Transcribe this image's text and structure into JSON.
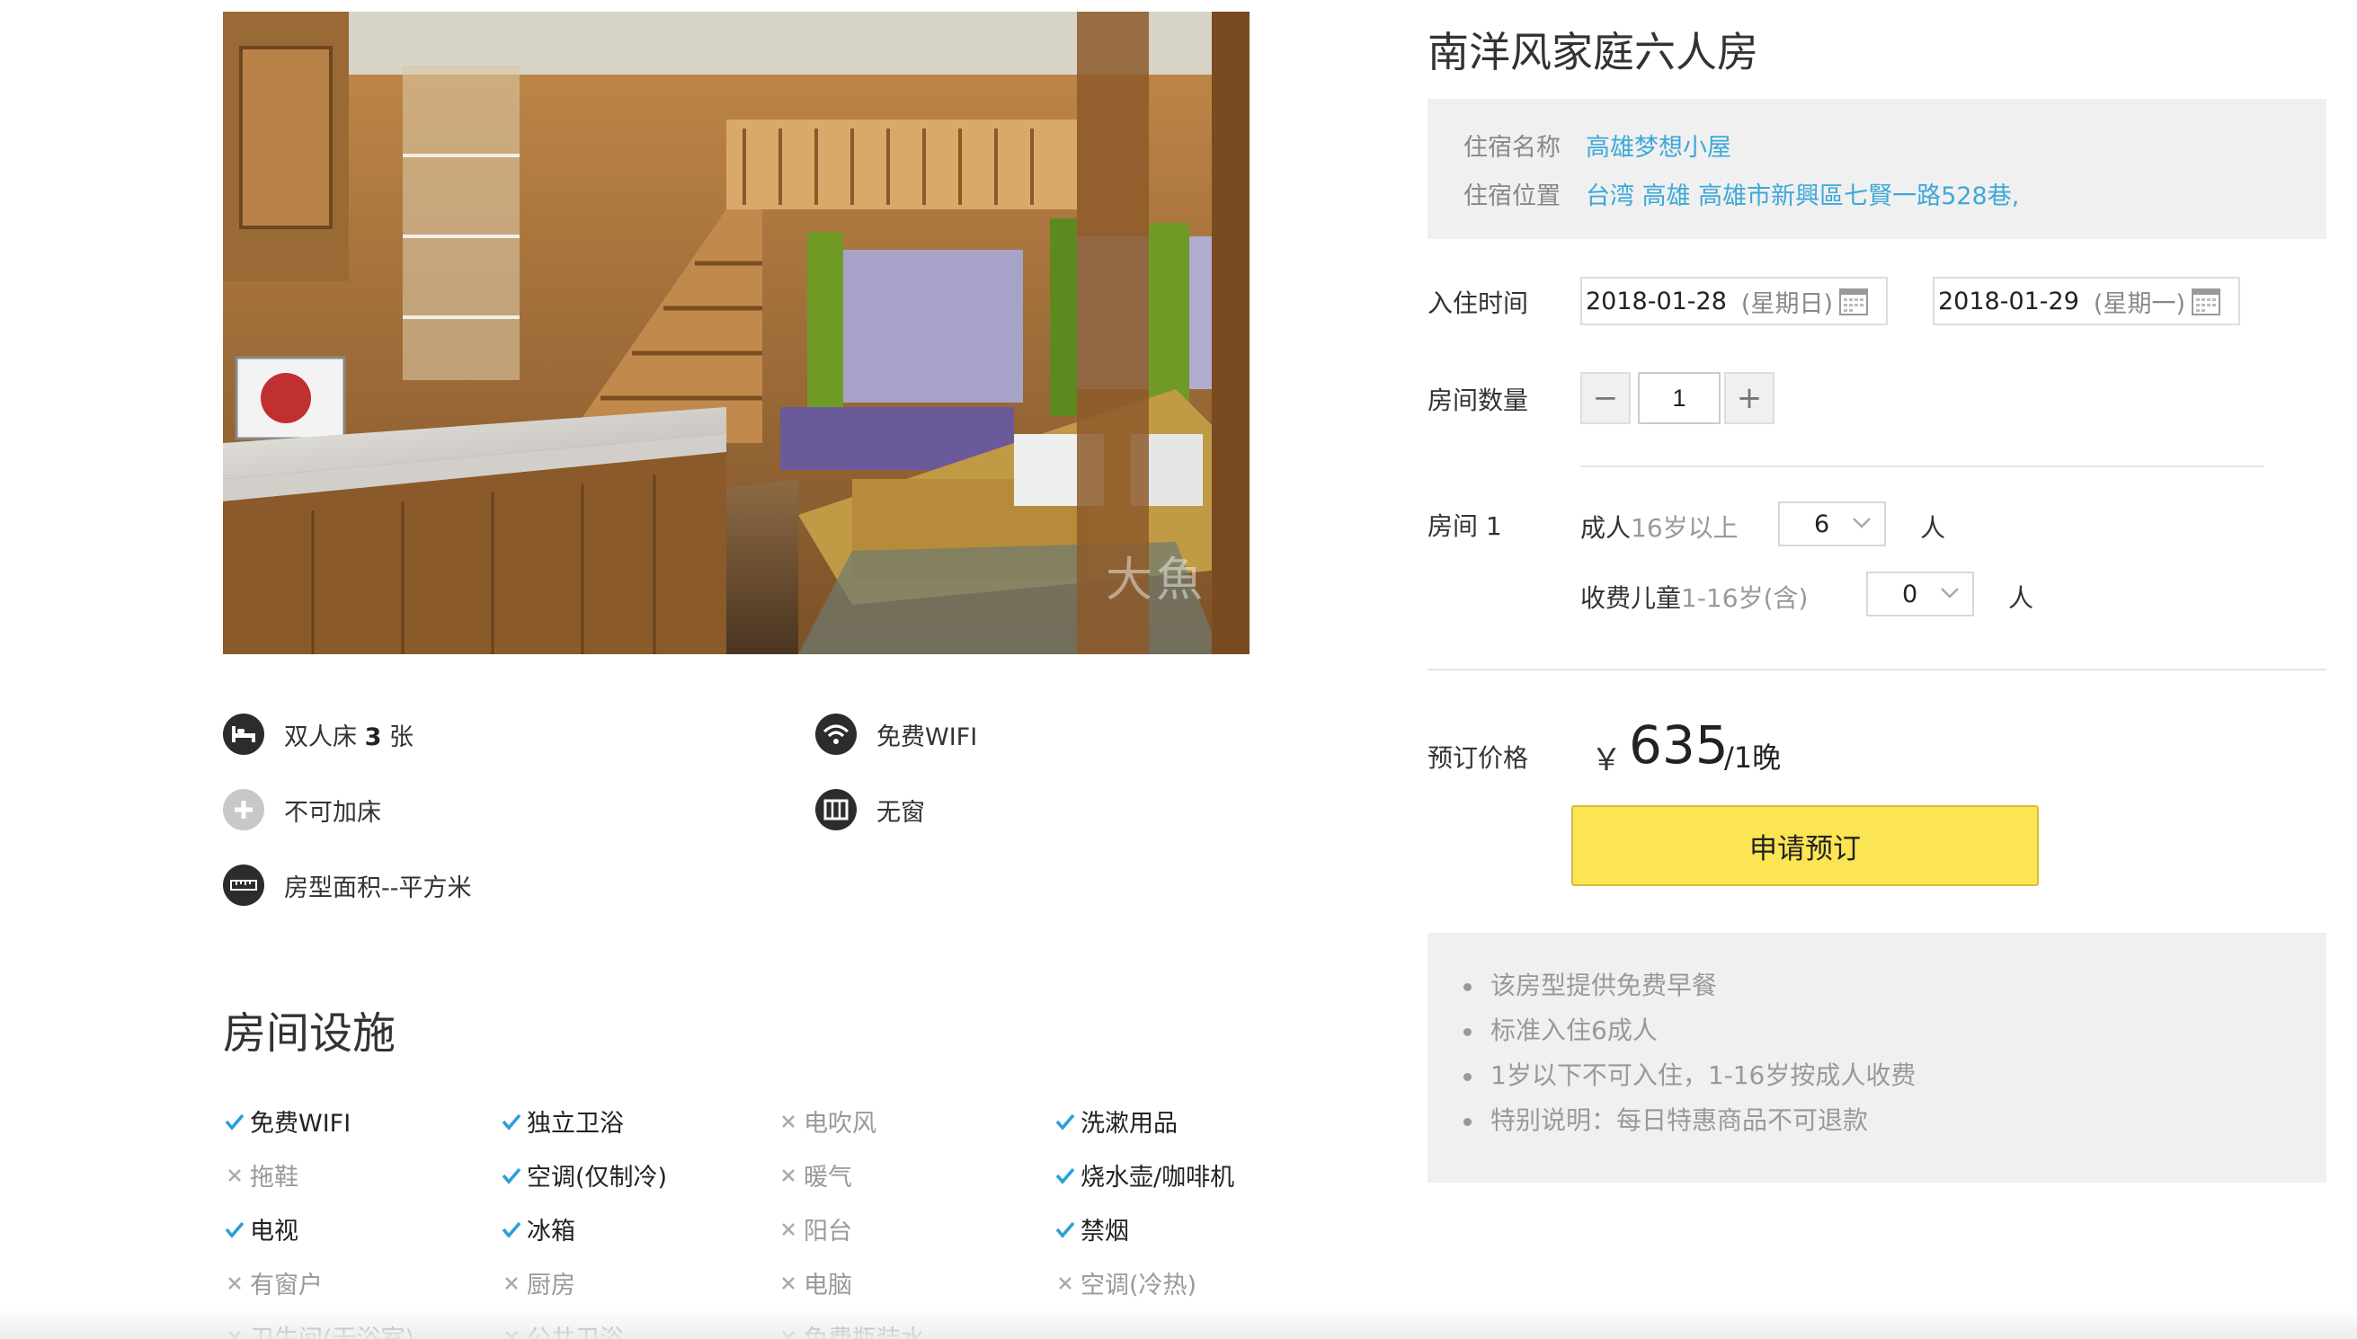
{
  "photo": {
    "watermark": "大魚"
  },
  "features": [
    {
      "icon": "bed-icon",
      "pre": "双人床 ",
      "bold": "3",
      "post": " 张"
    },
    {
      "icon": "wifi-icon",
      "text": "免费WIFI"
    },
    {
      "icon": "plus-circle-icon",
      "text": "不可加床"
    },
    {
      "icon": "window-icon",
      "text": "无窗"
    },
    {
      "icon": "ruler-icon",
      "text": "房型面积--平方米"
    }
  ],
  "facilities_title": "房间设施",
  "facilities": [
    {
      "label": "免费WIFI",
      "available": true
    },
    {
      "label": "独立卫浴",
      "available": true
    },
    {
      "label": "电吹风",
      "available": false
    },
    {
      "label": "洗漱用品",
      "available": true
    },
    {
      "label": "拖鞋",
      "available": false
    },
    {
      "label": "空调(仅制冷)",
      "available": true
    },
    {
      "label": "暖气",
      "available": false
    },
    {
      "label": "烧水壶/咖啡机",
      "available": true
    },
    {
      "label": "电视",
      "available": true
    },
    {
      "label": "冰箱",
      "available": true
    },
    {
      "label": "阳台",
      "available": false
    },
    {
      "label": "禁烟",
      "available": true
    },
    {
      "label": "有窗户",
      "available": false
    },
    {
      "label": "厨房",
      "available": false
    },
    {
      "label": "电脑",
      "available": false
    },
    {
      "label": "空调(冷热)",
      "available": false
    },
    {
      "label": "卫生间(无浴室)",
      "available": false
    },
    {
      "label": "公共卫浴",
      "available": false
    },
    {
      "label": "免费瓶装水",
      "available": false
    }
  ],
  "room": {
    "title": "南洋风家庭六人房",
    "lodging_name_label": "住宿名称",
    "lodging_name": "高雄梦想小屋",
    "lodging_location_label": "住宿位置",
    "lodging_location": "台湾 高雄 高雄市新興區七賢一路528巷,"
  },
  "booking": {
    "checkin_label": "入住时间",
    "checkin_date": "2018-01-28",
    "checkin_weekday": "(星期日)",
    "checkout_date": "2018-01-29",
    "checkout_weekday": "(星期一)",
    "rooms_label": "房间数量",
    "minus": "−",
    "plus": "+",
    "rooms_value": "1",
    "room_label": "房间 1",
    "adult_label": "成人",
    "adult_hint": "16岁以上",
    "adult_count": "6",
    "child_label": "收费儿童",
    "child_hint": "1-16岁(含)",
    "child_count": "0",
    "unit": "人"
  },
  "price": {
    "label": "预订价格",
    "currency": "￥",
    "value": "635",
    "unit": "/1晚"
  },
  "book_button": "申请预订",
  "notes": [
    "该房型提供免费早餐",
    "标准入住6成人",
    "1岁以下不可入住，1-16岁按成人收费",
    "特别说明：每日特惠商品不可退款"
  ],
  "colors": {
    "accent_link": "#3ea8d8",
    "check_mark": "#2a9fd8",
    "book_button": "#fce553",
    "panel_bg": "#f0f0f0"
  }
}
